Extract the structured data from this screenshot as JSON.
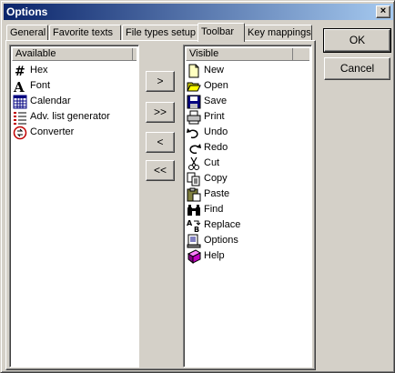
{
  "window": {
    "title": "Options",
    "close_label": "×"
  },
  "tabs": [
    {
      "label": "General",
      "active": false
    },
    {
      "label": "Favorite texts",
      "active": false
    },
    {
      "label": "File types setup",
      "active": false
    },
    {
      "label": "Toolbar",
      "active": true
    },
    {
      "label": "Key mappings",
      "active": false
    }
  ],
  "available": {
    "header": "Available",
    "items": [
      {
        "label": "Hex",
        "icon": "hash-icon"
      },
      {
        "label": "Font",
        "icon": "font-icon"
      },
      {
        "label": "Calendar",
        "icon": "calendar-icon"
      },
      {
        "label": "Adv. list generator",
        "icon": "list-generator-icon"
      },
      {
        "label": "Converter",
        "icon": "converter-icon"
      }
    ]
  },
  "visible": {
    "header": "Visible",
    "items": [
      {
        "label": "New",
        "icon": "new-document-icon"
      },
      {
        "label": "Open",
        "icon": "open-folder-icon"
      },
      {
        "label": "Save",
        "icon": "save-disk-icon"
      },
      {
        "label": "Print",
        "icon": "printer-icon"
      },
      {
        "label": "Undo",
        "icon": "undo-icon"
      },
      {
        "label": "Redo",
        "icon": "redo-icon"
      },
      {
        "label": "Cut",
        "icon": "scissors-icon"
      },
      {
        "label": "Copy",
        "icon": "copy-icon"
      },
      {
        "label": "Paste",
        "icon": "paste-icon"
      },
      {
        "label": "Find",
        "icon": "binoculars-icon"
      },
      {
        "label": "Replace",
        "icon": "replace-icon"
      },
      {
        "label": "Options",
        "icon": "options-icon"
      },
      {
        "label": "Help",
        "icon": "help-book-icon"
      }
    ]
  },
  "move_buttons": {
    "add_one": ">",
    "add_all": ">>",
    "remove_one": "<",
    "remove_all": "<<"
  },
  "dialog_buttons": {
    "ok": "OK",
    "cancel": "Cancel"
  },
  "colors": {
    "title_bar_start": "#0a246a",
    "title_bar_end": "#a6caf0",
    "face": "#d4d0c8"
  }
}
